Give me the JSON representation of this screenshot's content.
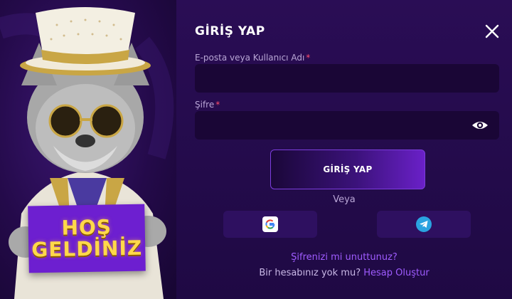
{
  "hero": {
    "sign_line1": "HOŞ",
    "sign_line2": "GELDİNİZ"
  },
  "form": {
    "title": "GİRİŞ YAP",
    "username": {
      "label": "E-posta veya Kullanıcı Adı",
      "required_mark": "*",
      "value": "",
      "placeholder": ""
    },
    "password": {
      "label": "Şifre",
      "required_mark": "*",
      "value": "",
      "placeholder": ""
    },
    "submit_label": "GİRİŞ YAP",
    "or_label": "Veya",
    "social": [
      {
        "name": "google",
        "icon": "google-icon"
      },
      {
        "name": "telegram",
        "icon": "telegram-icon"
      }
    ],
    "forgot_password": "Şifrenizi mi unuttunuz?",
    "no_account_text": "Bir hesabınız yok mu?",
    "create_account": "Hesap Oluştur"
  },
  "colors": {
    "background": "#230b4a",
    "accent": "#9f5cff",
    "required": "#ff4d6d",
    "sign_text": "#ffd84a"
  }
}
